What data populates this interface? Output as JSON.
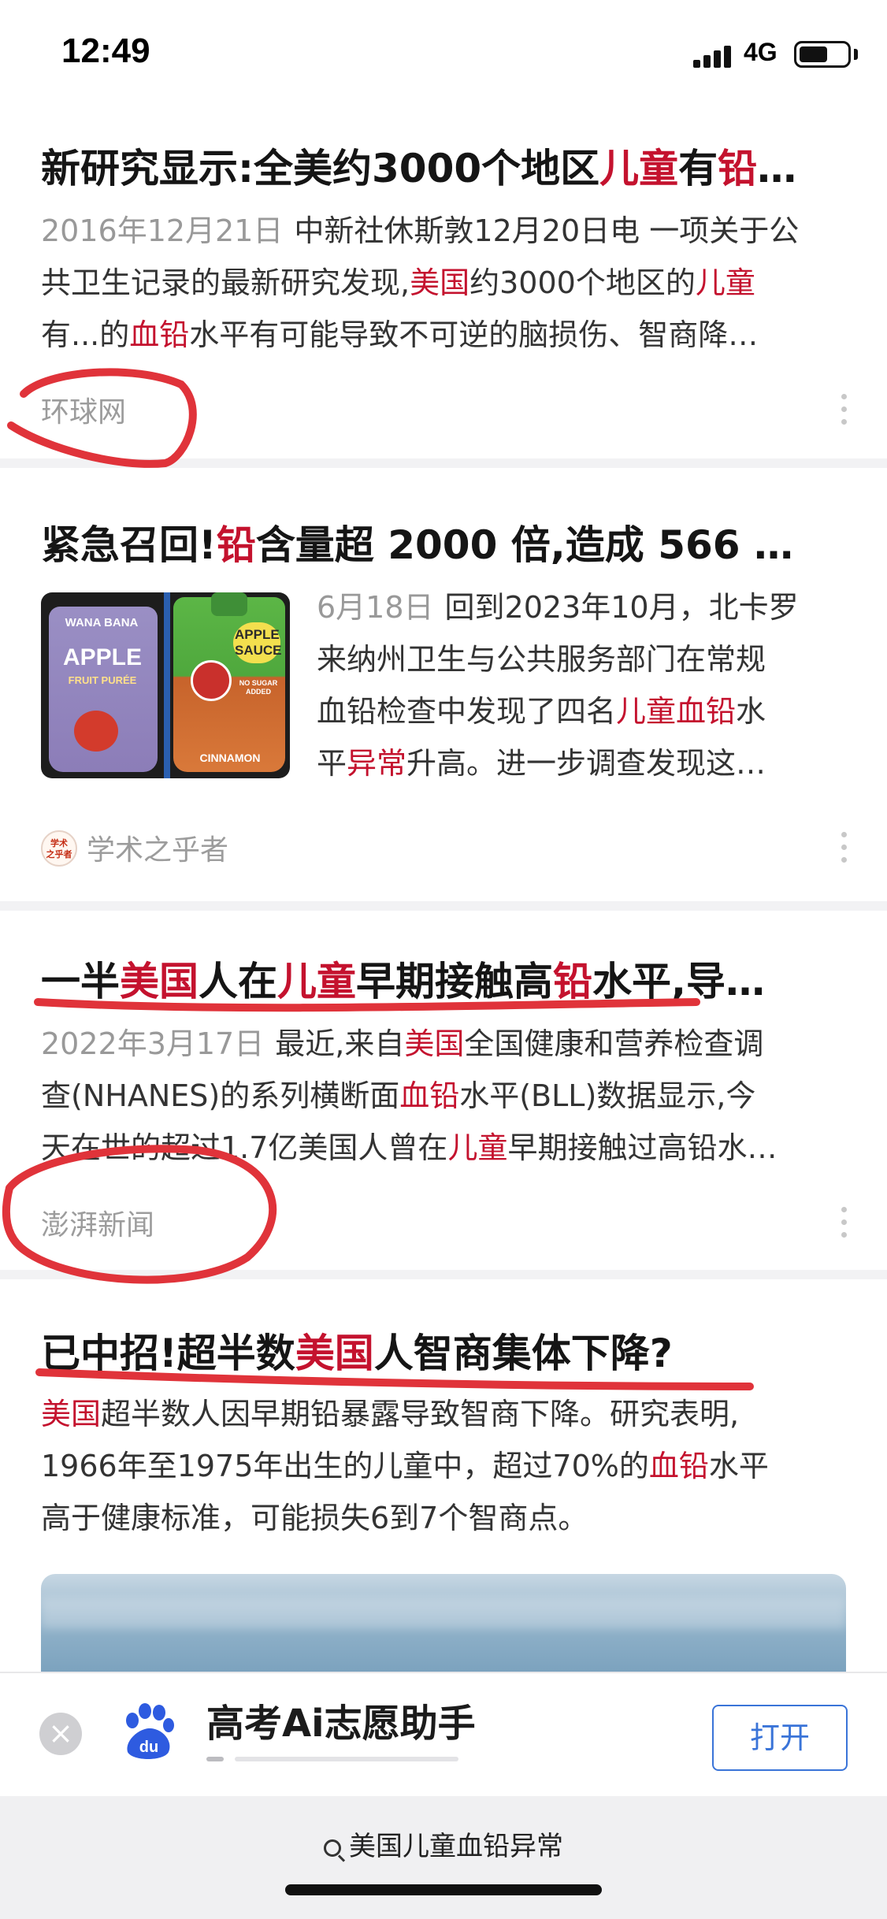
{
  "status_bar": {
    "time": "12:49",
    "network": "4G",
    "battery_level": 0.6
  },
  "articles": [
    {
      "title_segments": [
        {
          "text": "新研究显示:全美约3000个地区",
          "hl": false
        },
        {
          "text": "儿童",
          "hl": true
        },
        {
          "text": "有",
          "hl": false
        },
        {
          "text": "铅",
          "hl": true
        },
        {
          "text": "…",
          "hl": false
        }
      ],
      "date": "2016年12月21日",
      "lines": [
        [
          {
            "text": "中新社休斯敦12月20日电 一项关于公",
            "hl": false
          }
        ],
        [
          {
            "text": "共卫生记录的最新研究发现,",
            "hl": false
          },
          {
            "text": "美国",
            "hl": true
          },
          {
            "text": "约3000个地区的",
            "hl": false
          },
          {
            "text": "儿童",
            "hl": true
          }
        ],
        [
          {
            "text": "有...的",
            "hl": false
          },
          {
            "text": "血铅",
            "hl": true
          },
          {
            "text": "水平有可能导致不可逆的脑损伤、智商降…",
            "hl": false
          }
        ]
      ],
      "source": "环球网"
    },
    {
      "title_segments": [
        {
          "text": "紧急召回!",
          "hl": false
        },
        {
          "text": "铅",
          "hl": true
        },
        {
          "text": "含量超 2000 倍,造成 566 …",
          "hl": false
        }
      ],
      "date": "6月18日",
      "lines": [
        [
          {
            "text": "回到2023年10月，北卡罗",
            "hl": false
          }
        ],
        [
          {
            "text": "来纳州卫生与公共服务部门在常规",
            "hl": false
          }
        ],
        [
          {
            "text": "血铅检查中发现了四名",
            "hl": false
          },
          {
            "text": "儿童血铅",
            "hl": true
          },
          {
            "text": "水",
            "hl": false
          }
        ],
        [
          {
            "text": "平",
            "hl": false
          },
          {
            "text": "异常",
            "hl": true
          },
          {
            "text": "升高。进一步调查发现这…",
            "hl": false
          }
        ]
      ],
      "thumb_labels": {
        "left_brand": "WANA BANA",
        "left_product": "APPLE",
        "left_sub": "FRUIT PURÉE",
        "right_product": "APPLE SAUCE",
        "right_sub": "CINNAMON",
        "right_badge": "NO SUGAR ADDED"
      },
      "source_logo_text": "学术之乎者",
      "source": "学术之乎者"
    },
    {
      "title_segments": [
        {
          "text": "一半",
          "hl": false
        },
        {
          "text": "美国",
          "hl": true
        },
        {
          "text": "人在",
          "hl": false
        },
        {
          "text": "儿童",
          "hl": true
        },
        {
          "text": "早期接触高",
          "hl": false
        },
        {
          "text": "铅",
          "hl": true
        },
        {
          "text": "水平,导…",
          "hl": false
        }
      ],
      "date": "2022年3月17日",
      "lines": [
        [
          {
            "text": "最近,来自",
            "hl": false
          },
          {
            "text": "美国",
            "hl": true
          },
          {
            "text": "全国健康和营养检查调",
            "hl": false
          }
        ],
        [
          {
            "text": "查(NHANES)的系列横断面",
            "hl": false
          },
          {
            "text": "血铅",
            "hl": true
          },
          {
            "text": "水平(BLL)数据显示,今",
            "hl": false
          }
        ],
        [
          {
            "text": "天在世的超过1.7亿美国人曾在",
            "hl": false
          },
          {
            "text": "儿童",
            "hl": true
          },
          {
            "text": "早期接触过高铅水…",
            "hl": false
          }
        ]
      ],
      "source": "澎湃新闻"
    },
    {
      "title_segments": [
        {
          "text": "已中招!超半数",
          "hl": false
        },
        {
          "text": "美国",
          "hl": true
        },
        {
          "text": "人智商集体下降?",
          "hl": false
        }
      ],
      "lines": [
        [
          {
            "text": "美国",
            "hl": true
          },
          {
            "text": "超半数人因早期铅暴露导致智商下降。研究表明,",
            "hl": false
          }
        ],
        [
          {
            "text": "1966年至1975年出生的儿童中，超过70%的",
            "hl": false
          },
          {
            "text": "血铅",
            "hl": true
          },
          {
            "text": "水平",
            "hl": false
          }
        ],
        [
          {
            "text": "高于健康标准，可能损失6到7个智商点。",
            "hl": false
          }
        ]
      ]
    }
  ],
  "app_banner": {
    "name": "高考Ai志愿助手",
    "open_label": "打开",
    "close_icon": "close-icon",
    "app_icon": "baidu-paw-icon"
  },
  "search": {
    "query": "美国儿童血铅异常",
    "icon": "search-icon"
  },
  "colors": {
    "highlight": "#c4122e",
    "annotation": "#e0333a",
    "link": "#3a74d8"
  }
}
